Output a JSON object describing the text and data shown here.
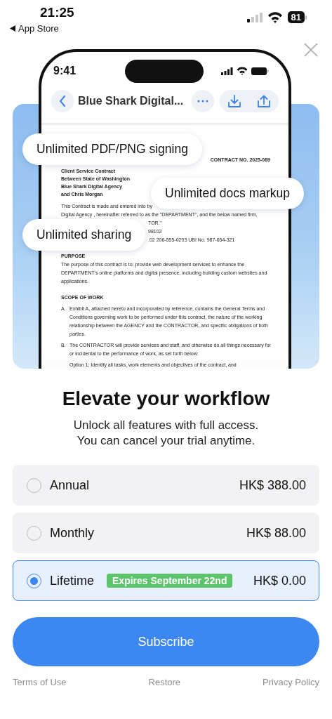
{
  "status_bar": {
    "time": "21:25",
    "back_label": "App Store",
    "battery": "81"
  },
  "hero": {
    "phone": {
      "time": "9:41",
      "title": "Blue Shark Digital...",
      "document": [
        {
          "kind": "number",
          "text": "CONTRACT NO. 2025-089"
        },
        {
          "kind": "title",
          "text": "Client Service Contract"
        },
        {
          "kind": "title",
          "text": "Between State of Washington"
        },
        {
          "kind": "title",
          "text": "Blue Shark Digital Agency"
        },
        {
          "kind": "title",
          "text": "and Chris Morgan"
        },
        {
          "kind": "text",
          "text": "This Contract is made and entered into by"
        },
        {
          "kind": "text",
          "text": "Digital Agency , hereinafter referred to as the \"DEPARTMENT\", and the below named firm,"
        },
        {
          "kind": "fragment",
          "text": "TOR.\""
        },
        {
          "kind": "fragment",
          "text": "98102"
        },
        {
          "kind": "fragment",
          "text": ".02 206-555-0203 UBI No. 987-654-321"
        },
        {
          "kind": "heading",
          "text": "PURPOSE"
        },
        {
          "kind": "paragraph",
          "text": "The purpose of this contract is to:  provide web development services to enhance the DEPARTMENT's online platforms and digital presence, including building custom websites and applications."
        },
        {
          "kind": "heading",
          "text": "SCOPE OF WORK"
        },
        {
          "kind": "item",
          "marker": "A.",
          "text": "Exhibit A, attached hereto and incorporated by reference, contains the General Terms and Conditions governing work to be performed under this contract, the nature of the working relationship between the AGENCY and the CONTRACTOR, and specific obligations of both parties."
        },
        {
          "kind": "item",
          "marker": "B.",
          "text": "The CONTRACTOR will provide services and staff, and otherwise do all things necessary for or incidental to the performance of work, as set forth below:"
        },
        {
          "kind": "option",
          "text": "Option 1:  Identify all tasks, work elements and objectives of the contract, and"
        }
      ]
    },
    "features": [
      "Unlimited PDF/PNG signing",
      "Unlimited docs markup",
      "Unlimited sharing"
    ]
  },
  "headline": "Elevate your workflow",
  "subtitle": [
    "Unlock all features with full access.",
    "You can cancel your trial anytime."
  ],
  "plans": [
    {
      "name": "Annual",
      "price": "HK$ 388.00",
      "selected": false
    },
    {
      "name": "Monthly",
      "price": "HK$ 88.00",
      "selected": false
    },
    {
      "name": "Lifetime",
      "price": "HK$ 0.00",
      "badge": "Expires September 22nd",
      "selected": true
    }
  ],
  "subscribe": "Subscribe",
  "footer": [
    "Terms of Use",
    "Restore",
    "Privacy Policy"
  ]
}
